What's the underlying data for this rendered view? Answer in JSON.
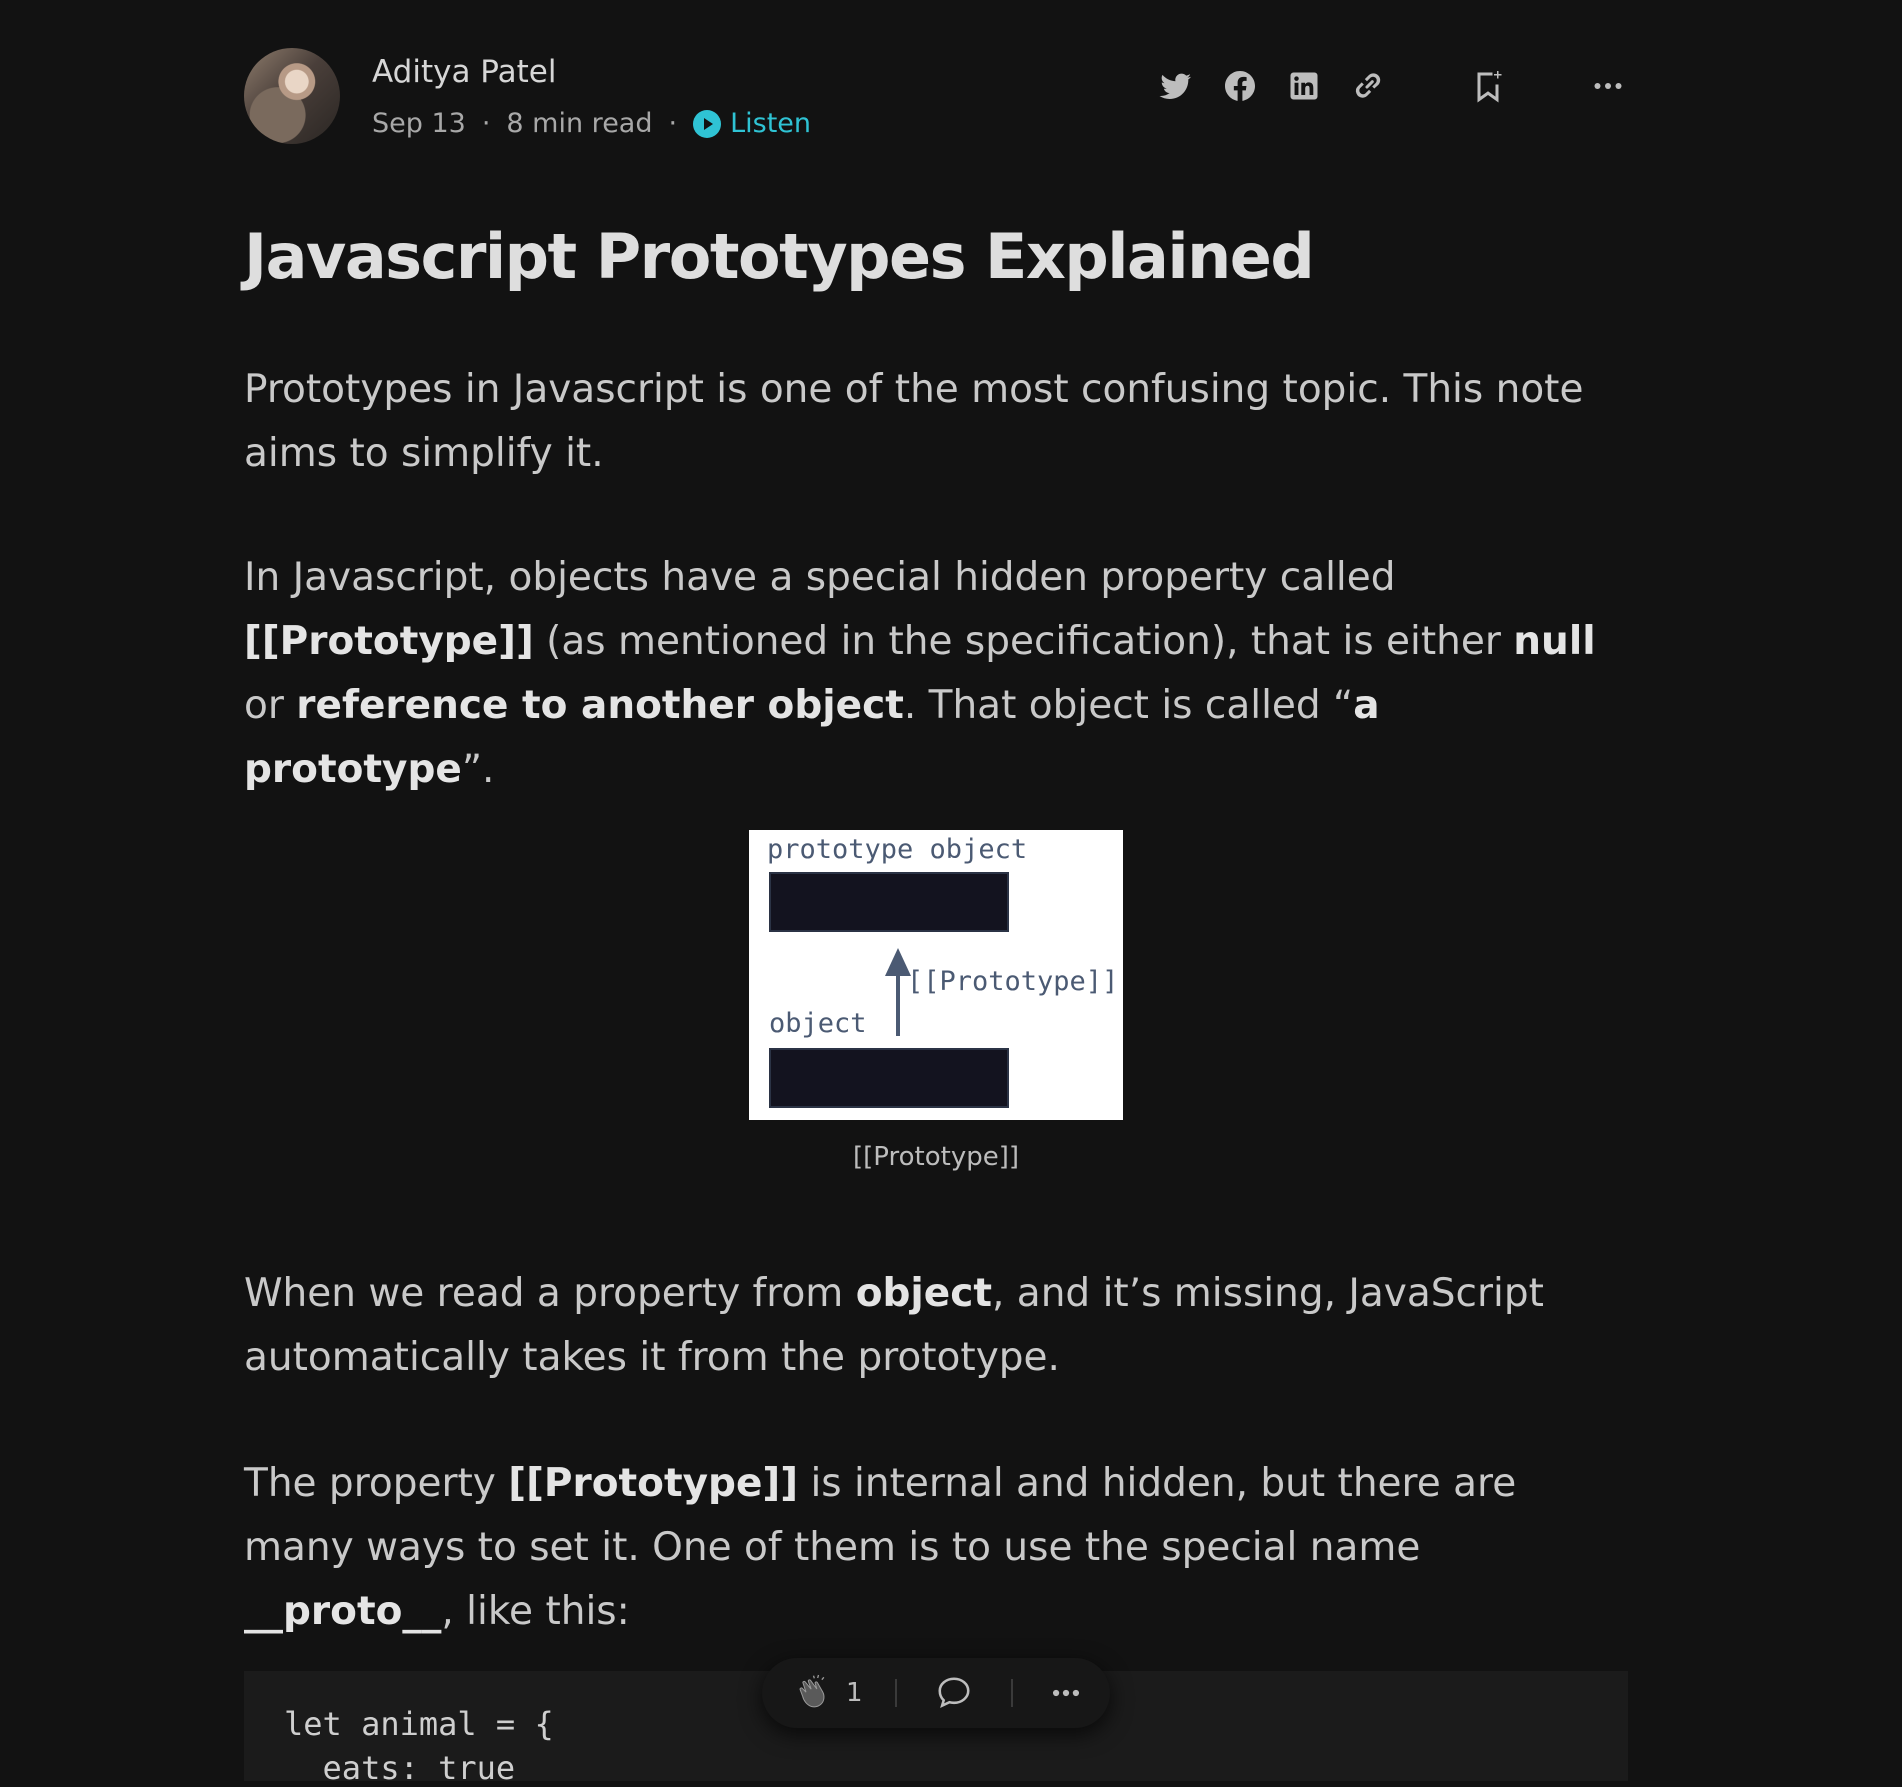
{
  "author": {
    "name": "Aditya Patel",
    "date": "Sep 13",
    "separator": "·",
    "read_time": "8 min read",
    "listen_label": "Listen"
  },
  "article": {
    "title": "Javascript Prototypes Explained",
    "p1": "Prototypes in Javascript is one of the most confusing topic. This note aims to simplify it.",
    "p2_parts": [
      "In Javascript, objects have a special hidden property called ",
      "[[Prototype]]",
      " (as mentioned in the specification), that is either ",
      "null",
      " or ",
      "reference to another object",
      ". That object is called “",
      "a prototype",
      "”."
    ],
    "figure": {
      "top_label": "prototype object",
      "arrow_label": "[[Prototype]]",
      "bottom_label": "object",
      "caption": "[[Prototype]]"
    },
    "p3_parts": [
      "When we read a property from ",
      "object",
      ", and it’s missing, JavaScript automatically takes it from the prototype."
    ],
    "p4_parts": [
      "The property ",
      "[[Prototype]]",
      " is internal and hidden, but there are many ways to set it. One of them is to use the special name ",
      "__proto__",
      ", like this:"
    ],
    "code_lines": [
      "let animal = {",
      "  eats: true"
    ]
  },
  "actions": {
    "icons": [
      "twitter-icon",
      "facebook-icon",
      "linkedin-icon",
      "link-icon",
      "bookmark-icon",
      "more-icon"
    ]
  },
  "floating_bar": {
    "clap_count": "1"
  },
  "colors": {
    "background": "#121212",
    "accent": "#2fc3d4"
  }
}
